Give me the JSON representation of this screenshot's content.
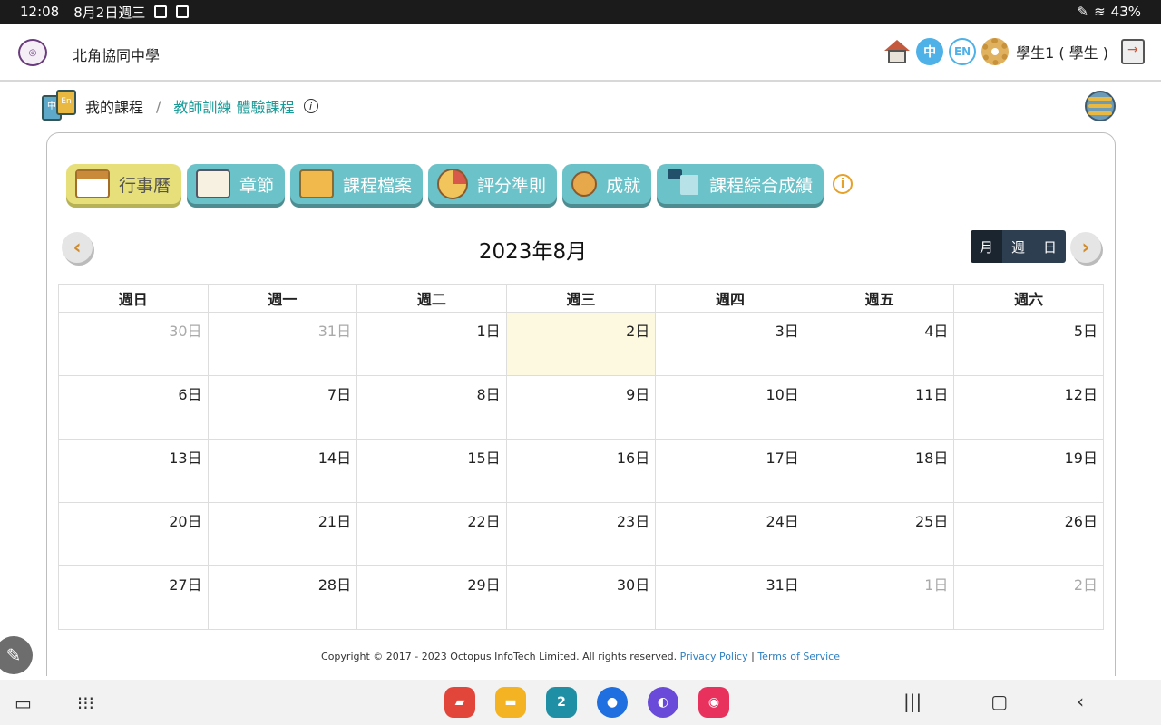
{
  "statusbar": {
    "time": "12:08",
    "date": "8月2日週三",
    "battery": "43%"
  },
  "header": {
    "school_name": "北角協同中學",
    "lang_zh": "中",
    "lang_en": "EN",
    "user": "學生1 ( 學生 )"
  },
  "breadcrumb": {
    "root": "我的課程",
    "separator": "/",
    "current": "教師訓練 體驗課程",
    "info": "i"
  },
  "tabs": [
    {
      "label": "行事曆",
      "icon": "calendar-icon",
      "active": true
    },
    {
      "label": "章節",
      "icon": "book-icon"
    },
    {
      "label": "課程檔案",
      "icon": "folder-icon"
    },
    {
      "label": "評分準則",
      "icon": "pie-chart-icon"
    },
    {
      "label": "成就",
      "icon": "medal-icon"
    },
    {
      "label": "課程綜合成績",
      "icon": "blocks-icon"
    }
  ],
  "tabs_info": "i",
  "calendar": {
    "title": "2023年8月",
    "views": [
      "月",
      "週",
      "日"
    ],
    "active_view": "月",
    "weekdays": [
      "週日",
      "週一",
      "週二",
      "週三",
      "週四",
      "週五",
      "週六"
    ],
    "weeks": [
      [
        "30日",
        "31日",
        "1日",
        "2日",
        "3日",
        "4日",
        "5日"
      ],
      [
        "6日",
        "7日",
        "8日",
        "9日",
        "10日",
        "11日",
        "12日"
      ],
      [
        "13日",
        "14日",
        "15日",
        "16日",
        "17日",
        "18日",
        "19日"
      ],
      [
        "20日",
        "21日",
        "22日",
        "23日",
        "24日",
        "25日",
        "26日"
      ],
      [
        "27日",
        "28日",
        "29日",
        "30日",
        "31日",
        "1日",
        "2日"
      ]
    ],
    "today": "2日"
  },
  "footer": {
    "copyright": "Copyright © 2017 - 2023 Octopus InfoTech Limited. All rights reserved.",
    "privacy": "Privacy Policy",
    "sep": "|",
    "terms": "Terms of Service"
  },
  "taskbar": {
    "calendar_badge": "2"
  }
}
